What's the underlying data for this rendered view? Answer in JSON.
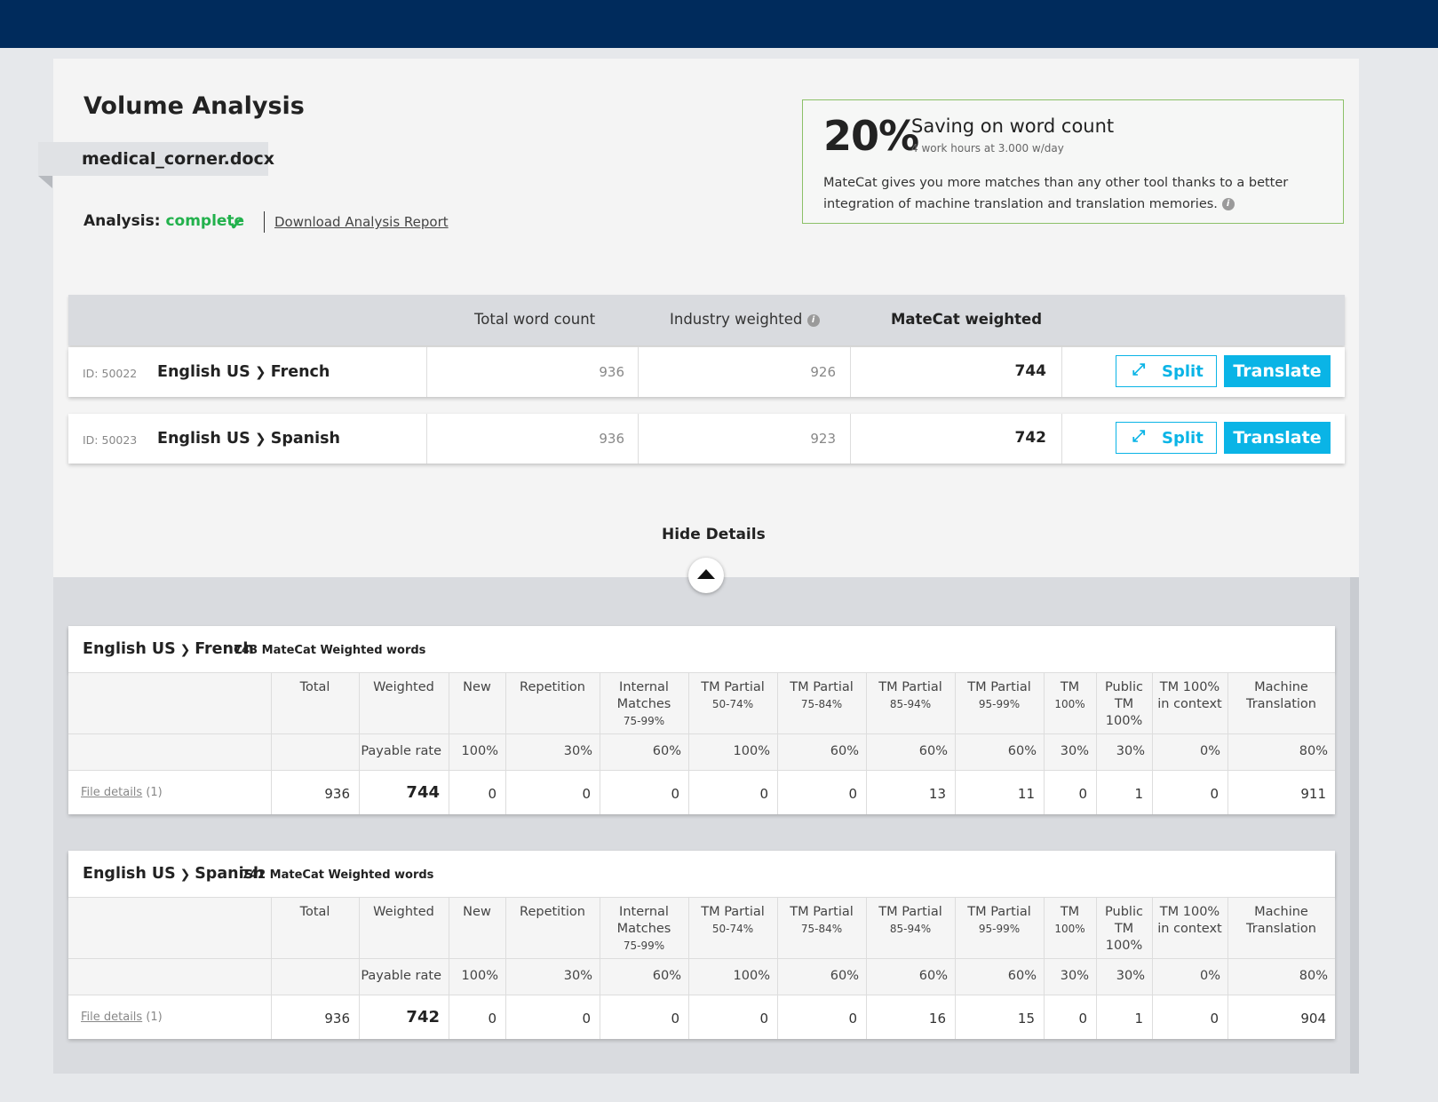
{
  "page": {
    "title": "Volume Analysis",
    "filename": "medical_corner.docx",
    "analysis_label": "Analysis:",
    "analysis_status": "complete",
    "download_label": "Download Analysis Report"
  },
  "saving": {
    "percent": "20%",
    "headline": "Saving on word count",
    "subline": "4 work hours at 3.000 w/day",
    "description": "MateCat gives you more matches than any other tool thanks to a better integration of machine translation and translation memories."
  },
  "summary": {
    "headers": {
      "total": "Total word count",
      "industry": "Industry weighted",
      "matecat": "MateCat weighted"
    },
    "rows": [
      {
        "id": "ID: 50022",
        "source": "English US",
        "target": "French",
        "total": "936",
        "industry": "926",
        "matecat": "744",
        "split": "Split",
        "translate": "Translate"
      },
      {
        "id": "ID: 50023",
        "source": "English US",
        "target": "Spanish",
        "total": "936",
        "industry": "923",
        "matecat": "742",
        "split": "Split",
        "translate": "Translate"
      }
    ]
  },
  "details_toggle": "Hide Details",
  "details": {
    "headers": [
      {
        "main": "Total",
        "sub": ""
      },
      {
        "main": "Weighted",
        "sub": ""
      },
      {
        "main": "New",
        "sub": ""
      },
      {
        "main": "Repetition",
        "sub": ""
      },
      {
        "main": "Internal Matches",
        "sub": "75-99%"
      },
      {
        "main": "TM Partial",
        "sub": "50-74%"
      },
      {
        "main": "TM Partial",
        "sub": "75-84%"
      },
      {
        "main": "TM Partial",
        "sub": "85-94%"
      },
      {
        "main": "TM Partial",
        "sub": "95-99%"
      },
      {
        "main": "TM",
        "sub": "100%"
      },
      {
        "main": "Public TM 100%",
        "sub": ""
      },
      {
        "main": "TM 100% in context",
        "sub": ""
      },
      {
        "main": "Machine Translation",
        "sub": ""
      }
    ],
    "payable_label": "Payable rate",
    "rates": [
      "100%",
      "30%",
      "60%",
      "100%",
      "60%",
      "60%",
      "60%",
      "30%",
      "30%",
      "0%",
      "80%"
    ],
    "file_details_label": "File details",
    "file_count": "(1)",
    "blocks": [
      {
        "source": "English US",
        "target": "French",
        "weighted_words": "743 MateCat Weighted words",
        "values": [
          "936",
          "744",
          "0",
          "0",
          "0",
          "0",
          "0",
          "13",
          "11",
          "0",
          "1",
          "0",
          "911"
        ]
      },
      {
        "source": "English US",
        "target": "Spanish",
        "weighted_words": "742 MateCat Weighted words",
        "values": [
          "936",
          "742",
          "0",
          "0",
          "0",
          "0",
          "0",
          "16",
          "15",
          "0",
          "1",
          "0",
          "904"
        ]
      }
    ]
  }
}
